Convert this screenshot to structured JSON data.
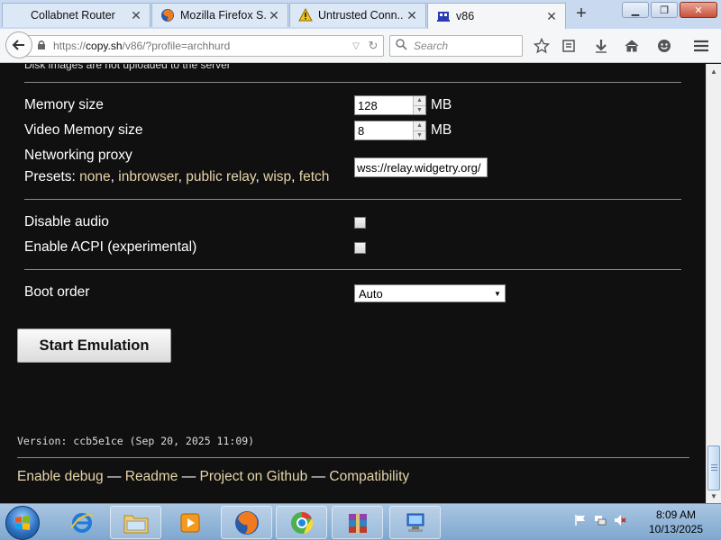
{
  "browser": {
    "tabs": [
      {
        "label": "Collabnet Router",
        "icon": "none"
      },
      {
        "label": "Mozilla Firefox S...",
        "icon": "firefox-icon"
      },
      {
        "label": "Untrusted Conn...",
        "icon": "warning-icon"
      },
      {
        "label": "v86",
        "icon": "v86-icon",
        "active": true
      }
    ],
    "url_prefix": "https://",
    "url_host": "copy.sh",
    "url_path": "/v86/?profile=archhurd",
    "search_placeholder": "Search"
  },
  "page": {
    "disk_note": "Disk images are not uploaded to the server",
    "memory": {
      "label": "Memory size",
      "value": "128",
      "unit": "MB"
    },
    "video_memory": {
      "label": "Video Memory size",
      "value": "8",
      "unit": "MB"
    },
    "networking": {
      "label": "Networking proxy",
      "presets_label": "Presets:",
      "presets": [
        "none",
        "inbrowser",
        "public relay",
        "wisp",
        "fetch"
      ],
      "value": "wss://relay.widgetry.org/"
    },
    "disable_audio": {
      "label": "Disable audio",
      "checked": false
    },
    "enable_acpi": {
      "label": "Enable ACPI (experimental)",
      "checked": false
    },
    "boot_order": {
      "label": "Boot order",
      "value": "Auto"
    },
    "start_button": "Start Emulation",
    "version": "Version: ccb5e1ce (Sep 20, 2025 11:09)",
    "footer_links": [
      "Enable debug",
      "Readme",
      "Project on Github",
      "Compatibility"
    ],
    "footer_separator": "—"
  },
  "taskbar": {
    "clock_time": "8:09 AM",
    "clock_date": "10/13/2025",
    "apps": [
      "internet-explorer-icon",
      "file-explorer-icon",
      "media-player-icon",
      "firefox-icon",
      "chrome-icon",
      "winrar-icon",
      "network-computer-icon"
    ]
  },
  "colors": {
    "page_bg": "#101010",
    "link": "#e6d5a8",
    "tabstrip": "#c9daf0"
  }
}
